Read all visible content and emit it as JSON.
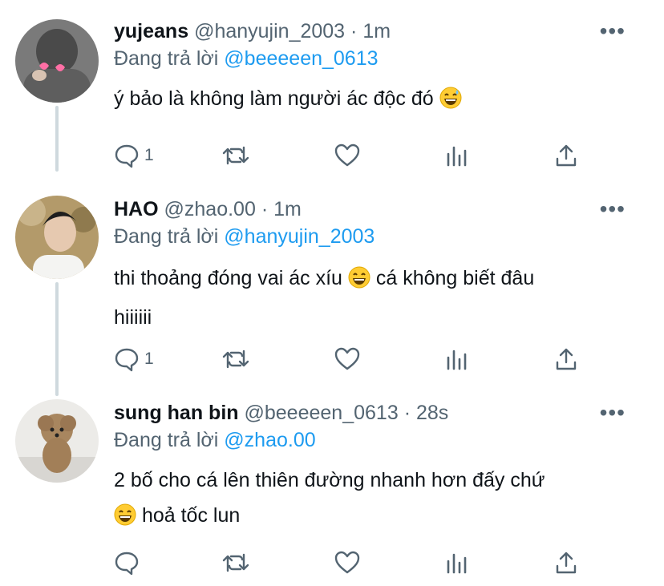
{
  "tweets": [
    {
      "name": "yujeans",
      "handle": "@hanyujin_2003",
      "sep": "·",
      "time": "1m",
      "reply_prefix": "Đang trả lời",
      "reply_to": "@beeeeen_0613",
      "text": "ý bảo là không làm người ác độc đó",
      "emoji": "grinning-sweat",
      "reply_count": "1",
      "avatar_colors": [
        "#6b6b6b",
        "#3a3a3a"
      ]
    },
    {
      "name": "HAO",
      "handle": "@zhao.00",
      "sep": "·",
      "time": "1m",
      "reply_prefix": "Đang trả lời",
      "reply_to": "@hanyujin_2003",
      "text_line1": "thi thoảng đóng vai ác xíu",
      "text_line1b": " cá không biết đâu",
      "text_line2": "hiiiiii",
      "emoji": "grin",
      "reply_count": "1",
      "avatar_colors": [
        "#b8a27a",
        "#2a2a2a"
      ]
    },
    {
      "name": "sung han bin",
      "handle": "@beeeeen_0613",
      "sep": "·",
      "time": "28s",
      "reply_prefix": "Đang trả lời",
      "reply_to": "@zhao.00",
      "text_line1": "2 bố cho cá lên thiên đường nhanh hơn đấy chứ",
      "text_line2": " hoả tốc lun",
      "emoji": "grin",
      "reply_count": "",
      "avatar_colors": [
        "#e9e7e3",
        "#9a7a5a"
      ]
    }
  ],
  "colors": {
    "link": "#1d9bf0",
    "meta": "#536471",
    "text": "#0f1419",
    "thread": "#cfd9de"
  },
  "more_label": "•••"
}
